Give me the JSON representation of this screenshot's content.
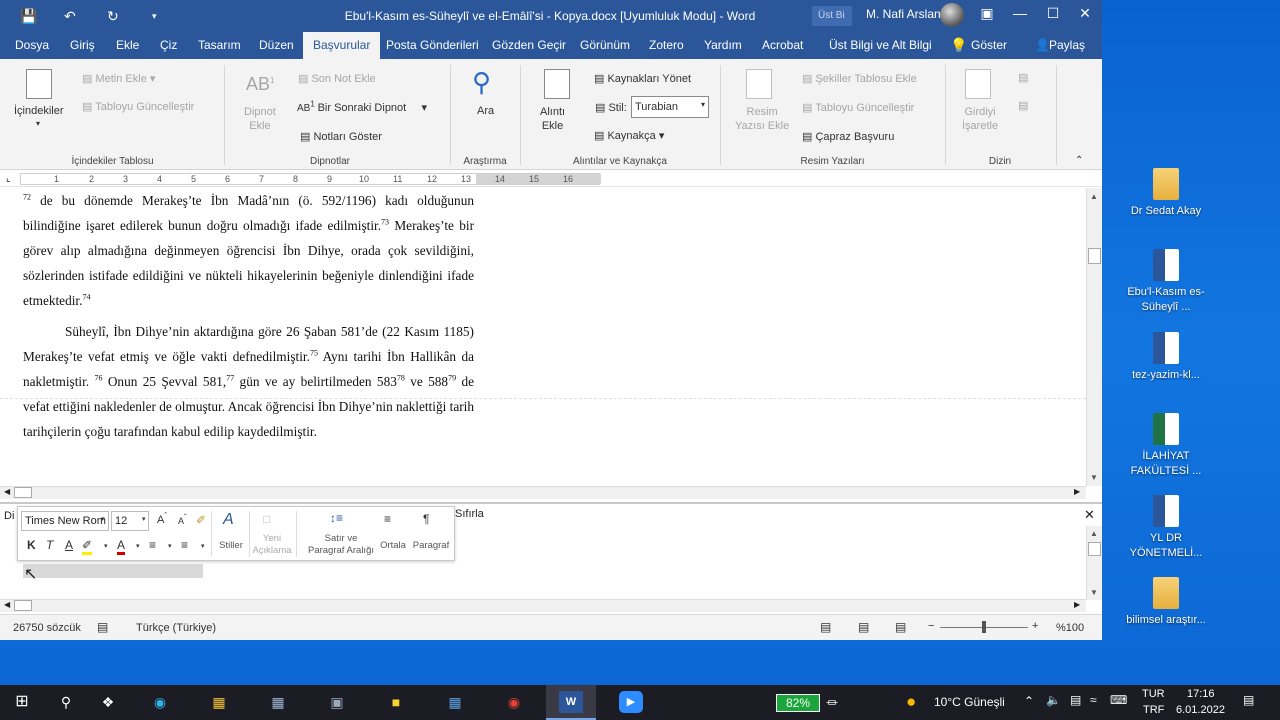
{
  "window": {
    "title": "Ebu'l-Kasım es-Süheylî ve el-Emâlî'si - Kopya.docx [Uyumluluk Modu]  -  Word",
    "search_placeholder": "Üst Bi",
    "user_name": "M. Nafi Arslan"
  },
  "tabs": [
    "Dosya",
    "Giriş",
    "Ekle",
    "Çiz",
    "Tasarım",
    "Düzen",
    "Başvurular",
    "Posta Gönderileri",
    "Gözden Geçir",
    "Görünüm",
    "Zotero",
    "Yardım",
    "Acrobat",
    "Üst Bilgi ve Alt Bilgi",
    "Göster",
    "Paylaş"
  ],
  "active_tab": "Başvurular",
  "ribbon": {
    "toc_button": "İçindekiler",
    "add_text": "Metin Ekle",
    "update_table": "Tabloyu Güncelleştir",
    "group_toc": "İçindekiler Tablosu",
    "insert_footnote": "Dipnot\nEkle",
    "insert_endnote": "Son Not Ekle",
    "next_footnote": "Bir Sonraki Dipnot",
    "show_notes": "Notları Göster",
    "group_footnotes": "Dipnotlar",
    "search": "Ara",
    "group_research": "Araştırma",
    "insert_citation": "Alıntı\nEkle",
    "manage_sources": "Kaynakları Yönet",
    "style_label": "Stil:",
    "style_value": "Turabian",
    "bibliography": "Kaynakça",
    "group_citations": "Alıntılar ve Kaynakça",
    "insert_caption": "Resim\nYazısı Ekle",
    "insert_tof": "Şekiller Tablosu Ekle",
    "update_table2": "Tabloyu Güncelleştir",
    "cross_reference": "Çapraz Başvuru",
    "group_captions": "Resim Yazıları",
    "mark_entry": "Girdiyi\nİşaretle",
    "group_index": "Dizin"
  },
  "ruler_numbers": [
    "1",
    "1",
    "2",
    "3",
    "4",
    "5",
    "6",
    "7",
    "8",
    "9",
    "10",
    "11",
    "12",
    "13",
    "14",
    "15",
    "16"
  ],
  "document": {
    "p1": [
      {
        "t": "72",
        "sup": true
      },
      {
        "t": " de bu dönemde Merakeş’te İbn Madâ’nın (ö. 592/1196) kadı olduğunun bilindiğine işaret edilerek bunun doğru olmadığı ifade edilmiştir."
      },
      {
        "t": "73",
        "sup": true
      },
      {
        "t": " Merakeş’te bir görev alıp almadığına değinmeyen öğrencisi İbn Dihye, orada çok sevildiğini, sözlerinden istifade edildiğini ve nükteli hikayelerinin beğeniyle dinlendiğini ifade etmektedir."
      },
      {
        "t": "74",
        "sup": true
      }
    ],
    "p2": [
      {
        "t": "Süheylî, İbn Dihye’nin aktardığına göre 26 Şaban 581’de (22 Kasım 1185) Merakeş’te vefat etmiş ve öğle vakti defnedilmiştir."
      },
      {
        "t": "75",
        "sup": true
      },
      {
        "t": " Aynı tarihi İbn Hallikân da nakletmiştir. "
      },
      {
        "t": "76",
        "sup": true
      },
      {
        "t": " Onun 25 Şevval 581,"
      },
      {
        "t": "77",
        "sup": true
      },
      {
        "t": " gün ve ay belirtilmeden 583"
      },
      {
        "t": "78",
        "sup": true
      },
      {
        "t": " ve 588"
      },
      {
        "t": "79",
        "sup": true
      },
      {
        "t": " de vefat ettiğini nakledenler de olmuştur. Ancak öğrencisi İbn Dihye’nin naklettiği tarih tarihçilerin çoğu tarafından kabul edilip kaydedilmiştir."
      }
    ]
  },
  "notes_pane": {
    "label_left": "Di",
    "label_right": "Sıfırla"
  },
  "mini_toolbar": {
    "font": "Times New Rom",
    "size": "12",
    "styles": "Stiller",
    "new_comment": "Yeni\nAçıklama",
    "line_spacing": "Satır ve\nParagraf Aralığı",
    "center": "Ortala",
    "paragraph": "Paragraf"
  },
  "status": {
    "words": "26750 sözcük",
    "language": "Türkçe (Türkiye)",
    "zoom": "%100",
    "zoom_level": 0.5
  },
  "desktop_icons": [
    {
      "label": "Dr Sedat Akay",
      "kind": "folder"
    },
    {
      "label": "Ebu'l-Kasım es-Süheylî ...",
      "kind": "word"
    },
    {
      "label": "tez-yazim-kl...",
      "kind": "word"
    },
    {
      "label": "İLAHİYAT FAKÜLTESİ ...",
      "kind": "excel"
    },
    {
      "label": "YL DR YÖNETMELİ...",
      "kind": "word"
    },
    {
      "label": "bilimsel araştır...",
      "kind": "folder"
    }
  ],
  "taskbar": {
    "battery": "82%",
    "weather": "10°C  Güneşli",
    "lang1": "TUR",
    "lang2": "TRF",
    "time": "17:16",
    "date": "6.01.2022"
  },
  "colors": {
    "word_blue": "#2b579a",
    "desktop": "#0a62d0"
  }
}
